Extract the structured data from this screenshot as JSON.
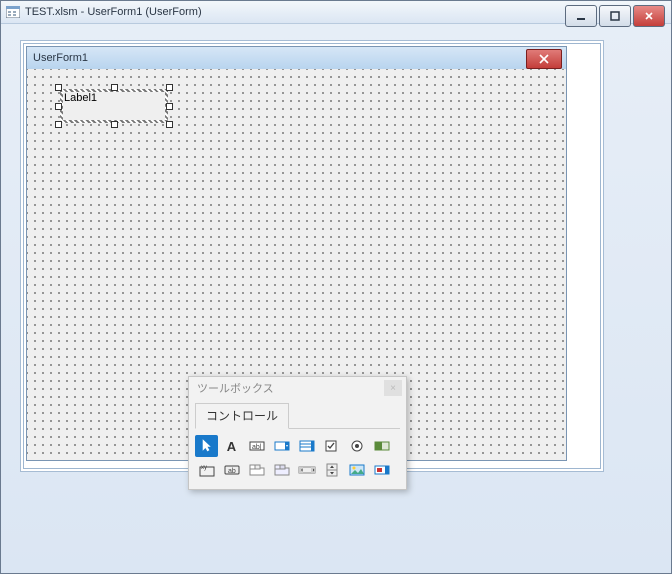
{
  "outerWindow": {
    "title": "TEST.xlsm - UserForm1 (UserForm)"
  },
  "userForm": {
    "title": "UserForm1",
    "label1": "Label1"
  },
  "toolbox": {
    "title": "ツールボックス",
    "tab": "コントロール",
    "tools": [
      {
        "name": "pointer",
        "label": "Select Objects"
      },
      {
        "name": "label",
        "label": "Label"
      },
      {
        "name": "textbox",
        "label": "TextBox"
      },
      {
        "name": "combobox",
        "label": "ComboBox"
      },
      {
        "name": "listbox",
        "label": "ListBox"
      },
      {
        "name": "checkbox",
        "label": "CheckBox"
      },
      {
        "name": "optionbutton",
        "label": "OptionButton"
      },
      {
        "name": "togglebutton",
        "label": "ToggleButton"
      },
      {
        "name": "frame",
        "label": "Frame"
      },
      {
        "name": "commandbutton",
        "label": "CommandButton"
      },
      {
        "name": "tabstrip",
        "label": "TabStrip"
      },
      {
        "name": "multipage",
        "label": "MultiPage"
      },
      {
        "name": "scrollbar",
        "label": "ScrollBar"
      },
      {
        "name": "spinbutton",
        "label": "SpinButton"
      },
      {
        "name": "image",
        "label": "Image"
      },
      {
        "name": "refedit",
        "label": "RefEdit"
      }
    ]
  }
}
